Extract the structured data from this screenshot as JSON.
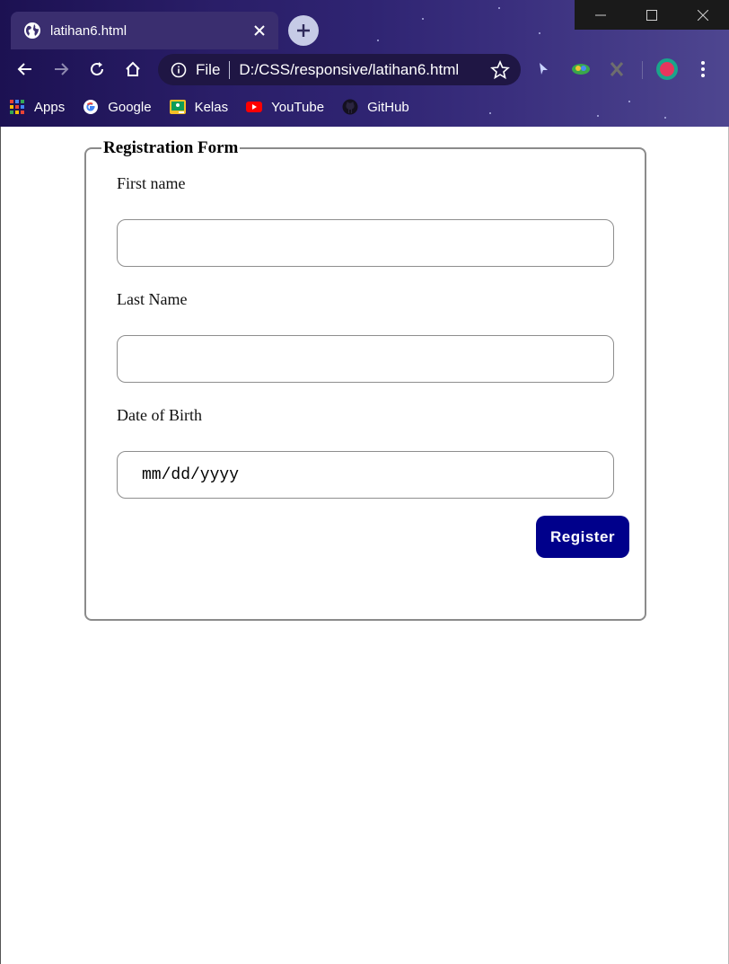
{
  "browser": {
    "tab": {
      "title": "latihan6.html",
      "icon": "globe-icon"
    },
    "toolbar": {
      "back": "arrow-left-icon",
      "forward": "arrow-right-icon",
      "reload": "reload-icon",
      "home": "home-icon",
      "scheme": "File",
      "url": "D:/CSS/responsive/latihan6.html"
    },
    "bookmarks": [
      {
        "label": "Apps",
        "icon": "apps-grid-icon"
      },
      {
        "label": "Google",
        "icon": "google-icon"
      },
      {
        "label": "Kelas",
        "icon": "classroom-icon"
      },
      {
        "label": "YouTube",
        "icon": "youtube-icon"
      },
      {
        "label": "GitHub",
        "icon": "github-icon"
      }
    ]
  },
  "form": {
    "legend": "Registration Form",
    "fields": [
      {
        "label": "First name",
        "value": ""
      },
      {
        "label": "Last Name",
        "value": ""
      },
      {
        "label": "Date of Birth",
        "placeholder": "mm/dd/yyyy"
      }
    ],
    "submit_label": "Register"
  },
  "colors": {
    "register_button": "#00008b",
    "chrome_background": "#2a1e68"
  }
}
